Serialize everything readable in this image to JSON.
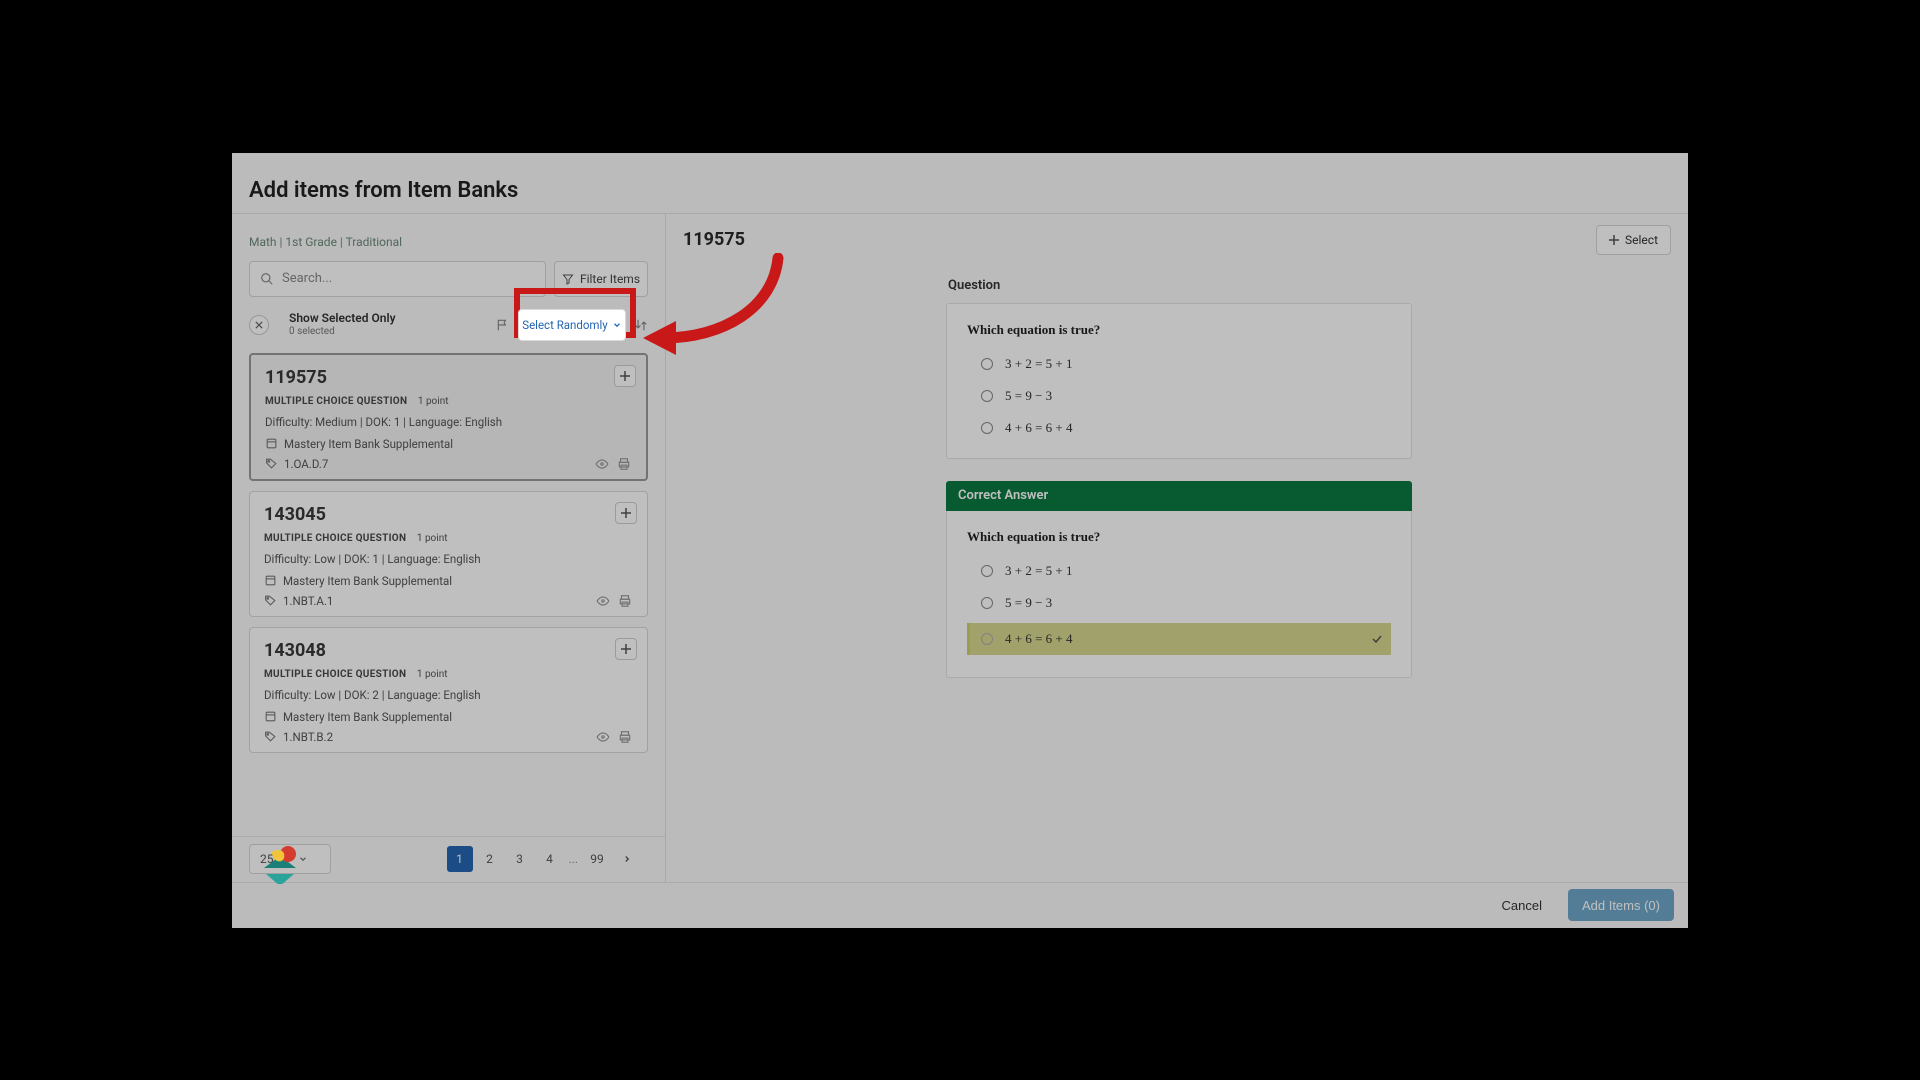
{
  "page": {
    "title": "Add items from Item Banks"
  },
  "breadcrumb": "Math | 1st Grade | Traditional",
  "search": {
    "placeholder": "Search..."
  },
  "filter": {
    "label": "Filter Items"
  },
  "selection": {
    "show_only_label": "Show Selected Only",
    "count_label": "0 selected",
    "random_label": "Select Randomly"
  },
  "items": [
    {
      "id": "119575",
      "type_label": "MULTIPLE CHOICE QUESTION",
      "points_label": "1 point",
      "meta": "Difficulty: Medium  |  DOK: 1  |  Language: English",
      "bank": "Mastery Item Bank Supplemental",
      "standard": "1.OA.D.7",
      "selected": true
    },
    {
      "id": "143045",
      "type_label": "MULTIPLE CHOICE QUESTION",
      "points_label": "1 point",
      "meta": "Difficulty: Low  |  DOK: 1  |  Language: English",
      "bank": "Mastery Item Bank Supplemental",
      "standard": "1.NBT.A.1",
      "selected": false
    },
    {
      "id": "143048",
      "type_label": "MULTIPLE CHOICE QUESTION",
      "points_label": "1 point",
      "meta": "Difficulty: Low  |  DOK: 2  |  Language: English",
      "bank": "Mastery Item Bank Supplemental",
      "standard": "1.NBT.B.2",
      "selected": false
    }
  ],
  "pagination": {
    "per_page_label": "25",
    "pages": [
      "1",
      "2",
      "3",
      "4"
    ],
    "ellipsis": "...",
    "last": "99",
    "active_index": 0
  },
  "preview": {
    "id": "119575",
    "select_label": "Select",
    "question_label": "Question",
    "question_text": "Which equation is true?",
    "options": [
      "3 + 2 = 5 + 1",
      "5 = 9 − 3",
      "4 + 6 = 6 + 4"
    ],
    "correct_header": "Correct Answer",
    "correct_index": 2
  },
  "footer": {
    "cancel": "Cancel",
    "add_items": "Add Items (0)"
  },
  "colors": {
    "accent_blue": "#2466b3",
    "correct_green": "#0b7a42",
    "highlight_red": "#c81818"
  }
}
